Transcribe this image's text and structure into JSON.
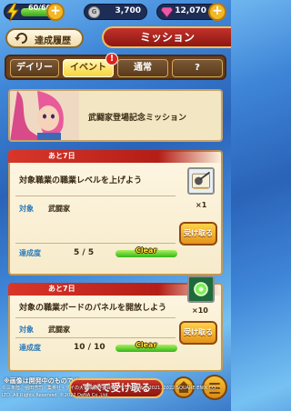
{
  "status": {
    "stamina": "60/60",
    "stamina_fraction": 1.0,
    "coins": "3,700",
    "coin_symbol": "G",
    "gems": "12,070",
    "plus_label": "+"
  },
  "header": {
    "history_label": "達成履歴",
    "title": "ミッション"
  },
  "tabs": [
    {
      "label": "デイリー",
      "active": false
    },
    {
      "label": "イベント",
      "active": true,
      "badge": "!"
    },
    {
      "label": "通常",
      "active": false
    },
    {
      "label": "?",
      "active": false
    }
  ],
  "banner": {
    "text": "武闘家登場記念ミッション"
  },
  "missions": [
    {
      "ribbon": "あと7日",
      "title": "対象職業の職業レベルを上げよう",
      "target_label": "対象",
      "target_value": "武闘家",
      "progress_label": "達成度",
      "progress_value": "5 / 5",
      "progress_fraction": 1.0,
      "status": "Clear",
      "reward_qty": "×1",
      "reward_icon": "weapon-scroll-icon",
      "claim_label": "受け取る"
    },
    {
      "ribbon": "あと7日",
      "title": "対象の職業ボードのパネルを開放しよう",
      "target_label": "対象",
      "target_value": "武闘家",
      "progress_label": "達成度",
      "progress_value": "10 / 10",
      "progress_fraction": 1.0,
      "status": "Clear",
      "reward_qty": "×10",
      "reward_icon": "green-orb-icon",
      "claim_label": "受け取る"
    }
  ],
  "footer": {
    "note": "※画像は開発中のものです。",
    "copyright": "©三条陸、稲田浩司／集英社・ダイの大冒険製作委員会・テレビ東京 ©2021, 2022 SQUARE ENIX CO., LTD. All Rights Reserved. ©2022 DeNA Co.,Ltd.",
    "claim_all_label": "すべて受け取る"
  },
  "colors": {
    "accent_red": "#c83328",
    "gold": "#f4b824",
    "clear_yellow": "#ffe23a"
  }
}
